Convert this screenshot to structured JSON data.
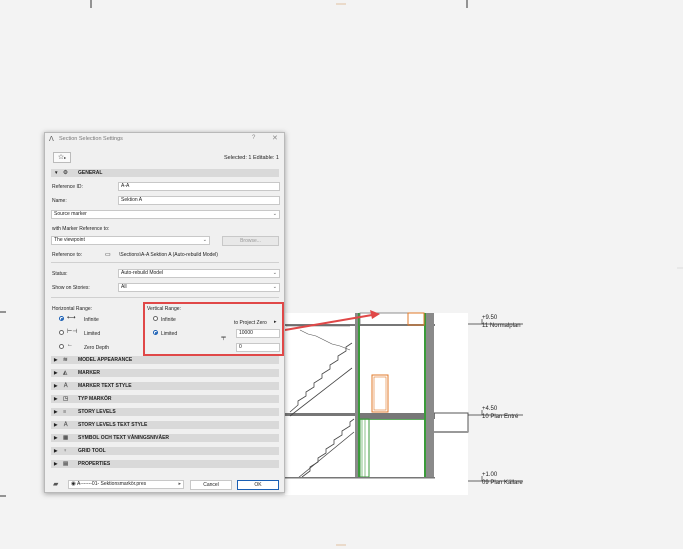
{
  "dialog": {
    "title": "Section Selection Settings",
    "help": "?",
    "close": "✕",
    "selection_info": "Selected: 1 Editable: 1",
    "general": {
      "header": "GENERAL",
      "reference_id_label": "Reference ID:",
      "reference_id_value": "A-A",
      "name_label": "Name:",
      "name_value": "Sektion A",
      "source_marker": "Source marker",
      "marker_ref_label": "with Marker Reference to:",
      "marker_ref_value": "The viewpoint",
      "browse": "Browse...",
      "reference_to_label": "Reference to:",
      "reference_to_value": "\\Sections\\A-A Sektion A (Auto-rebuild Model)",
      "status_label": "Status:",
      "status_value": "Auto-rebuild Model",
      "stories_label": "Show on Stories:",
      "stories_value": "All",
      "horizontal_range_label": "Horizontal Range:",
      "h_infinite": "Infinite",
      "h_limited": "Limited",
      "h_zero_depth": "Zero Depth",
      "vertical_range_label": "Vertical Range:",
      "v_infinite": "Infinite",
      "v_limited": "Limited",
      "to_project_zero": "to Project Zero",
      "top_value": "10000",
      "bottom_value": "0"
    },
    "panels": [
      "MODEL APPEARANCE",
      "MARKER",
      "MARKER TEXT STYLE",
      "TYP MARKÖR",
      "STORY LEVELS",
      "STORY LEVELS TEXT STYLE",
      "SYMBOL OCH TEXT VÅNINGSNIVÅER",
      "GRID TOOL",
      "PROPERTIES"
    ],
    "footer": {
      "layer_value": "A-------01- Sektionsmarkör.pres",
      "cancel": "Cancel",
      "ok": "OK"
    }
  },
  "levels": [
    {
      "value": "+9.50",
      "name": "11 Normalplan"
    },
    {
      "value": "+4.50",
      "name": "10 Plan Entré"
    },
    {
      "value": "+1.00",
      "name": "09 Plan Källare"
    }
  ],
  "colors": {
    "accent": "#1a5fb4",
    "highlight": "#e04848",
    "wall_green": "#3a9a3a",
    "door_orange": "#e07a2a"
  }
}
